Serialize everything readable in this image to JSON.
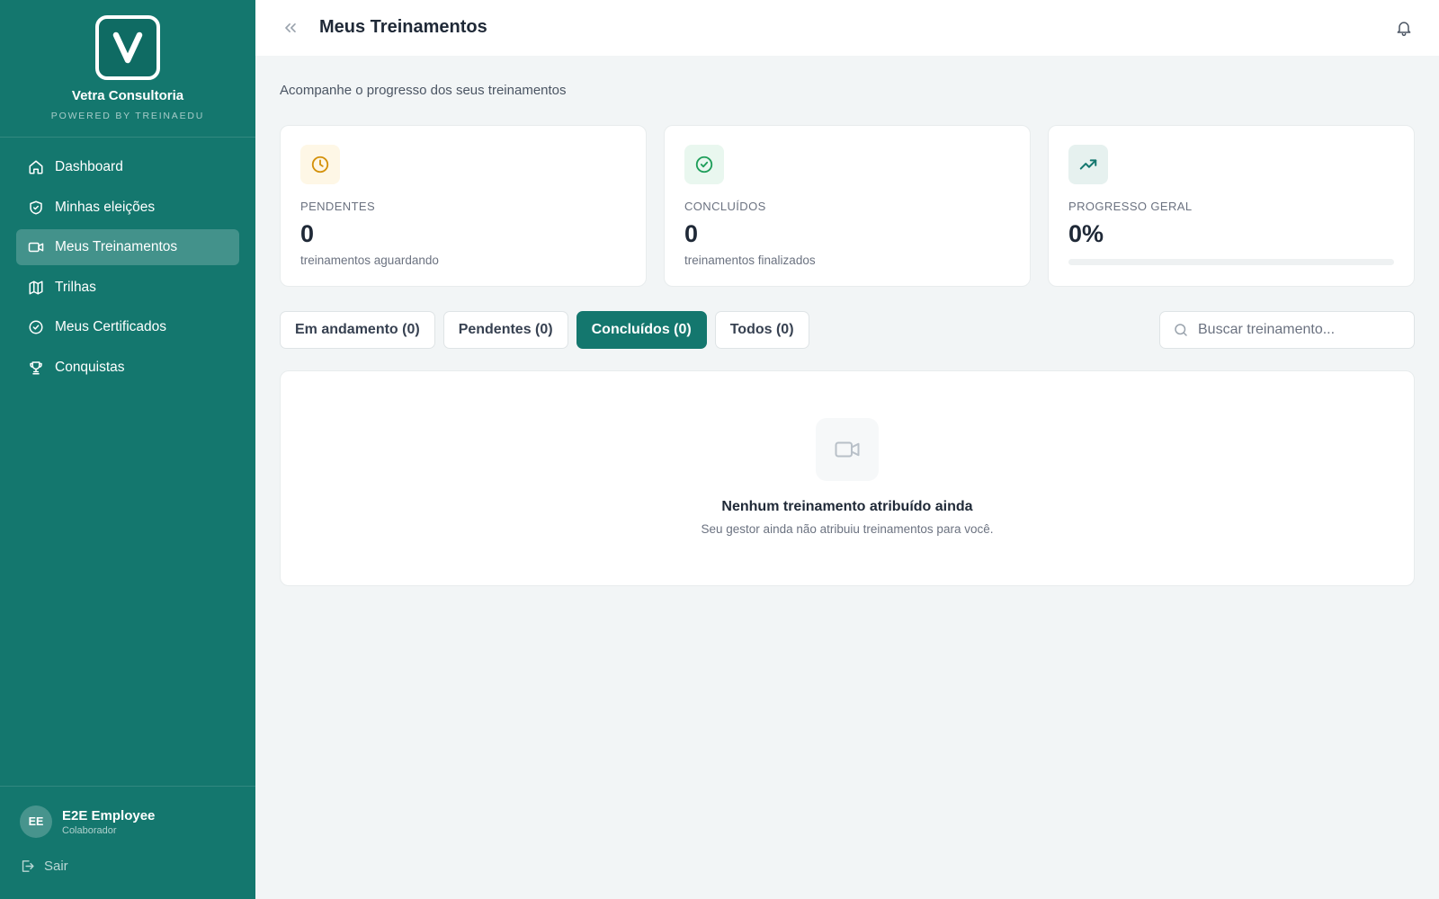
{
  "brand": {
    "name": "Vetra Consultoria",
    "powered_by": "POWERED BY TREINAEDU",
    "logo_letter": "V"
  },
  "sidebar": {
    "items": [
      {
        "label": "Dashboard",
        "icon": "home-icon",
        "active": false
      },
      {
        "label": "Minhas eleições",
        "icon": "shield-icon",
        "active": false
      },
      {
        "label": "Meus Treinamentos",
        "icon": "video-icon",
        "active": true
      },
      {
        "label": "Trilhas",
        "icon": "map-icon",
        "active": false
      },
      {
        "label": "Meus Certificados",
        "icon": "check-circle-icon",
        "active": false
      },
      {
        "label": "Conquistas",
        "icon": "trophy-icon",
        "active": false
      }
    ]
  },
  "user": {
    "initials": "EE",
    "name": "E2E Employee",
    "role": "Colaborador"
  },
  "logout": {
    "label": "Sair"
  },
  "header": {
    "title": "Meus Treinamentos"
  },
  "main": {
    "subtitle": "Acompanhe o progresso dos seus treinamentos",
    "cards": {
      "pending": {
        "label": "PENDENTES",
        "value": "0",
        "desc": "treinamentos aguardando"
      },
      "completed": {
        "label": "CONCLUÍDOS",
        "value": "0",
        "desc": "treinamentos finalizados"
      },
      "progress": {
        "label": "PROGRESSO GERAL",
        "value": "0%",
        "fraction": 0
      }
    },
    "tabs": [
      {
        "label": "Em andamento (0)",
        "active": false
      },
      {
        "label": "Pendentes (0)",
        "active": false
      },
      {
        "label": "Concluídos (0)",
        "active": true
      },
      {
        "label": "Todos (0)",
        "active": false
      }
    ],
    "search": {
      "placeholder": "Buscar treinamento..."
    },
    "empty": {
      "title": "Nenhum treinamento atribuído ainda",
      "desc": "Seu gestor ainda não atribuiu treinamentos para você."
    }
  },
  "colors": {
    "accent": "#14776e",
    "pending_bg": "#fef7e6",
    "pending_fg": "#d4910a",
    "completed_bg": "#e9f7ef",
    "completed_fg": "#1e9e5a",
    "progress_bg": "#e6f1ef",
    "progress_fg": "#14776e"
  }
}
